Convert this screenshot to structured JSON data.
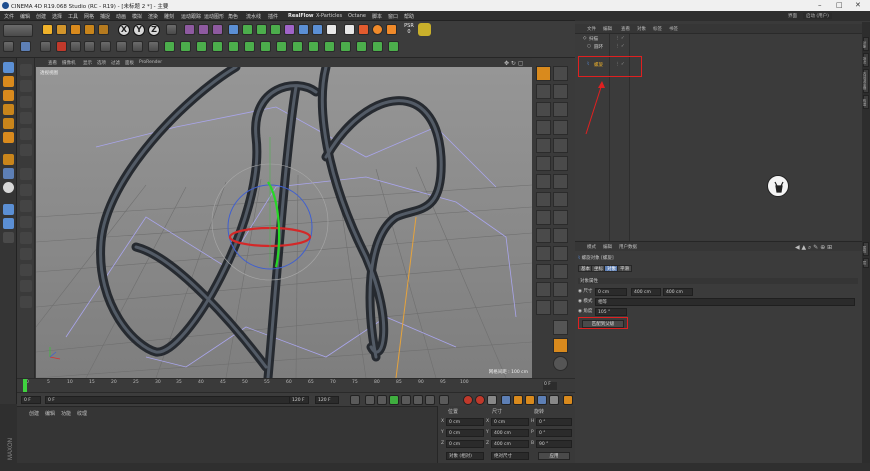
{
  "window": {
    "title": "CINEMA 4D R19.068 Studio (RC - R19) - [未标题 2 *] - 主要"
  },
  "menu": [
    "文件",
    "编辑",
    "创建",
    "选择",
    "工具",
    "网格",
    "捕捉",
    "动画",
    "模拟",
    "渲染",
    "雕刻",
    "运动跟踪",
    "运动图形",
    "角色",
    "流水线",
    "插件",
    "RealFlow",
    "X-Particles",
    "Octane",
    "脚本",
    "窗口",
    "帮助"
  ],
  "layout": {
    "label": "界面",
    "value": "启动 (用户)"
  },
  "toolbar": {
    "axes": [
      "X",
      "Y",
      "Z"
    ],
    "psr_label": "PSR",
    "psr_value": "0"
  },
  "viewport": {
    "menu": [
      "查看",
      "摄像机",
      "显示",
      "选项",
      "过滤",
      "面板",
      "ProRender"
    ],
    "title": "透视视图",
    "grid_info": "网格间距 : 100 cm"
  },
  "timeline": {
    "ticks": [
      "0",
      "5",
      "10",
      "15",
      "20",
      "25",
      "30",
      "35",
      "40",
      "45",
      "50",
      "55",
      "60",
      "65",
      "70",
      "75",
      "80",
      "85",
      "90",
      "95",
      "100"
    ],
    "frame_field": "0 F",
    "start_field": "0 F",
    "min_field": "0 F",
    "max_field": "120 F",
    "end_field": "120 F"
  },
  "bottom_panel": {
    "menu": [
      "创建",
      "编辑",
      "功能",
      "纹理"
    ]
  },
  "coordinates": {
    "headers": [
      "位置",
      "尺寸",
      "旋转"
    ],
    "rows": [
      {
        "axis": "X",
        "pos": "0 cm",
        "size": "0 cm",
        "rot_label": "H",
        "rot": "0 °"
      },
      {
        "axis": "Y",
        "pos": "0 cm",
        "size": "400 cm",
        "rot_label": "P",
        "rot": "0 °"
      },
      {
        "axis": "Z",
        "pos": "0 cm",
        "size": "400 cm",
        "rot_label": "B",
        "rot": "90 °"
      }
    ],
    "mode_select": "对象 (相对)",
    "size_select": "绝对尺寸",
    "apply_button": "应用"
  },
  "object_manager": {
    "menu": [
      "文件",
      "编辑",
      "查看",
      "对象",
      "标签",
      "书签"
    ],
    "objects": [
      {
        "name": "扫描",
        "level": 0
      },
      {
        "name": "圆环",
        "level": 1
      },
      {
        "name": "螺旋",
        "level": 1
      }
    ]
  },
  "attribute_manager": {
    "menu": [
      "模式",
      "编辑",
      "用户数据"
    ],
    "object_title": "螺旋对象 [螺旋]",
    "tabs": [
      "基本",
      "坐标",
      "对象",
      "平滑"
    ],
    "active_tab": "对象",
    "section": "对象属性",
    "rows": [
      {
        "label": "尺寸",
        "values": [
          "0 cm",
          "400 cm",
          "400 cm"
        ]
      },
      {
        "label": "模式",
        "values": [
          "相等"
        ]
      },
      {
        "label": "角度",
        "values": [
          "105 °"
        ]
      }
    ],
    "button": "匹配到父级"
  },
  "right_strip_tabs": [
    "对象",
    "场次",
    "内容浏览器",
    "构造",
    "属性",
    "层"
  ],
  "colors": {
    "highlight": "#e02020",
    "active_tab": "#5d7fb5",
    "viewport_bg": "#8a8a8a"
  }
}
